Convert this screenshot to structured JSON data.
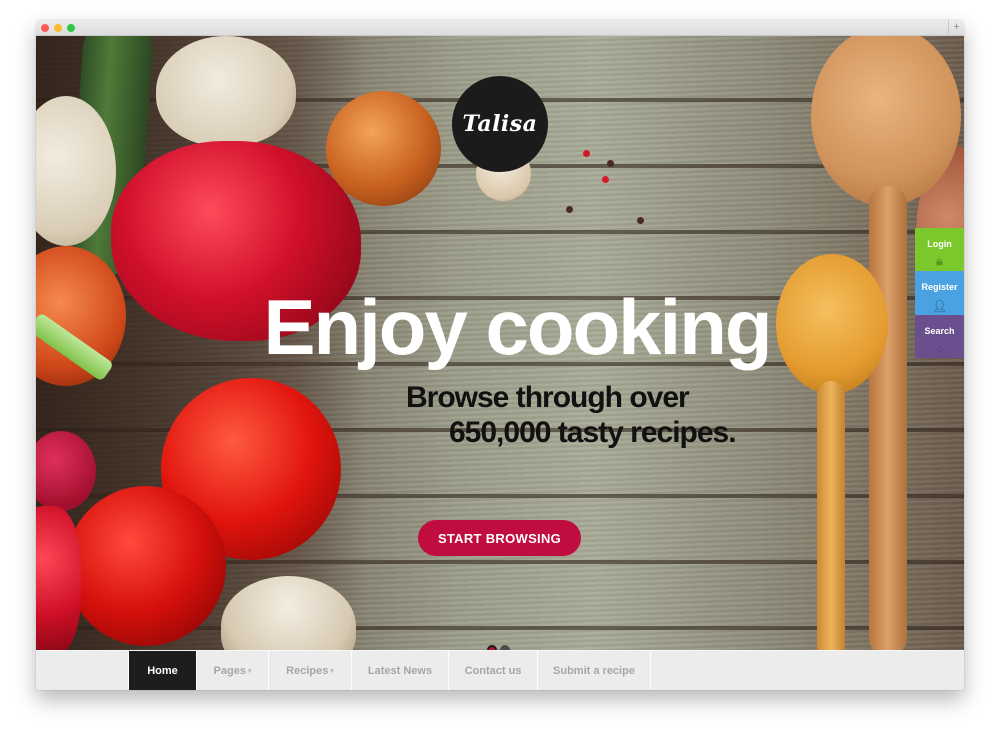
{
  "window": {
    "controls": [
      "close",
      "minimize",
      "maximize"
    ],
    "new_tab_icon": "+"
  },
  "hero": {
    "logo_text": "Talisa",
    "headline": "Enjoy cooking",
    "subheadline_line1": "Browse through over",
    "subheadline_line2": "650,000 tasty recipes.",
    "cta_label": "START BROWSING",
    "slider": {
      "total_slides": 2,
      "active_index": 0
    }
  },
  "side_panel": {
    "items": [
      {
        "label": "Login",
        "icon": "lock-icon",
        "color": "#7bc82c"
      },
      {
        "label": "Register",
        "icon": "user-icon",
        "color": "#4aa3e0"
      },
      {
        "label": "Search",
        "icon": "search-icon",
        "color": "#6a4f8e"
      }
    ]
  },
  "nav": {
    "items": [
      {
        "label": "Home",
        "active": true,
        "has_dropdown": false
      },
      {
        "label": "Pages",
        "active": false,
        "has_dropdown": true
      },
      {
        "label": "Recipes",
        "active": false,
        "has_dropdown": true
      },
      {
        "label": "Latest News",
        "active": false,
        "has_dropdown": false
      },
      {
        "label": "Contact us",
        "active": false,
        "has_dropdown": false
      },
      {
        "label": "Submit a recipe",
        "active": false,
        "has_dropdown": false
      }
    ],
    "dropdown_caret": "▾"
  },
  "colors": {
    "accent": "#c10c3f",
    "nav_active_bg": "#1d1d1d",
    "logo_bg": "#1b1b1b"
  }
}
